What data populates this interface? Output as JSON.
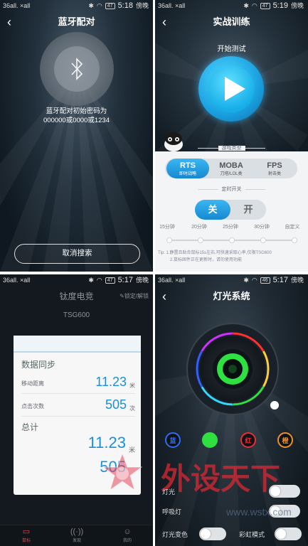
{
  "panel1": {
    "status": {
      "signal": "36all. ×all",
      "time": "5:18",
      "period": "傍晚",
      "battery": "47"
    },
    "title": "蓝牙配对",
    "pair_text_line1": "蓝牙配对初始密码为",
    "pair_text_line2": "000000或0000或1234",
    "cancel_label": "取消搜索"
  },
  "panel2": {
    "status": {
      "signal": "36all. ×all",
      "time": "5:19",
      "period": "傍晚",
      "battery": "47"
    },
    "title": "实战训练",
    "start_label": "开始测试",
    "game_type_label": "游戏类型",
    "modes": [
      {
        "name": "RTS",
        "sub": "即时战略",
        "active": true
      },
      {
        "name": "MOBA",
        "sub": "刀塔/LOL类",
        "active": false
      },
      {
        "name": "FPS",
        "sub": "射击类",
        "active": false
      }
    ],
    "timer_label": "定时开关",
    "toggle_off": "关",
    "toggle_on": "开",
    "ticks": [
      "15分钟",
      "20分钟",
      "25分钟",
      "30分钟",
      "自定义"
    ],
    "tip_line1": "Tip: 1.静置且贴合鼠标15s左右,可快速采取心率,仅限TSG600",
    "tip_line2": "2.鼠标固件正在更新时，请勿使用功能"
  },
  "panel3": {
    "status": {
      "signal": "36all. ×all",
      "time": "5:17",
      "period": "傍晚",
      "battery": "47"
    },
    "title": "钛度电竞",
    "lock_label": "锁定/解锁",
    "model": "TSG600",
    "sync_title": "数据同步",
    "rows": [
      {
        "label": "移动距离",
        "value": "11.23",
        "unit": "米"
      },
      {
        "label": "点击次数",
        "value": "505",
        "unit": "次"
      }
    ],
    "total_title": "总计",
    "total_distance": "11.23",
    "total_distance_unit": "米",
    "total_clicks": "505",
    "nav": [
      {
        "label": "鼠标",
        "active": true
      },
      {
        "label": "发现",
        "active": false
      },
      {
        "label": "我的",
        "active": false
      }
    ]
  },
  "panel4": {
    "status": {
      "signal": "36all. ×all",
      "time": "5:17",
      "period": "傍晚",
      "battery": "46"
    },
    "title": "灯光系统",
    "color_buttons": [
      {
        "label": "蓝",
        "color": "#2f6cf2"
      },
      {
        "label": "绿",
        "color": "#2ee040"
      },
      {
        "label": "红",
        "color": "#e83030"
      },
      {
        "label": "橙",
        "color": "#f0902a"
      }
    ],
    "switches": [
      {
        "label": "灯光"
      },
      {
        "label": "呼吸灯"
      }
    ],
    "bottom_left_label": "灯光变色",
    "bottom_right_label": "彩虹模式",
    "watermark_text": "外设天下",
    "watermark_url": "www.wstx.com"
  }
}
